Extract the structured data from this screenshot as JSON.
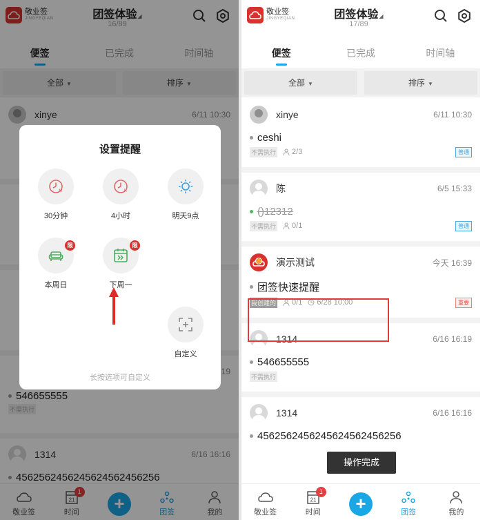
{
  "app": {
    "logo_cn": "敬业签",
    "logo_en": "JINGYEQIAN",
    "title": "团签体验",
    "title_caret": "◢"
  },
  "left": {
    "count": "16/89",
    "tabs": [
      "便签",
      "已完成",
      "时间轴"
    ],
    "filters": [
      "全部",
      "排序"
    ],
    "bg_cards": [
      {
        "name": "xinye",
        "time": "6/11 10:30"
      },
      {
        "name": "1314",
        "time": "6/16 16:16",
        "body": "4562562456245624562456256"
      }
    ],
    "bg_peek": {
      "card3_time": "6/16 16:19",
      "card3_body": "546655555",
      "card3_tag": "不需执行"
    },
    "dialog": {
      "title": "设置提醒",
      "options": [
        {
          "label": "30分钟",
          "icon": "clock-m-icon"
        },
        {
          "label": "4小时",
          "icon": "clock-h-icon"
        },
        {
          "label": "明天9点",
          "icon": "sun-icon"
        },
        {
          "label": "本周日",
          "icon": "sofa-icon",
          "badge": "限"
        },
        {
          "label": "下周一",
          "icon": "calendar-icon",
          "badge": "限"
        },
        {
          "label": "自定义",
          "icon": "custom-icon"
        }
      ],
      "hint": "长按选项可自定义"
    }
  },
  "right": {
    "count": "17/89",
    "tabs": [
      "便签",
      "已完成",
      "时间轴"
    ],
    "filters": [
      "全部",
      "排序"
    ],
    "cards": [
      {
        "name": "xinye",
        "time": "6/11 10:30",
        "body": "ceshi",
        "tag": "不需执行",
        "members": "2/3",
        "badge": "普通",
        "avatar": "photo"
      },
      {
        "name": "陈",
        "time": "6/5 15:33",
        "body": "()12312",
        "tag": "不需执行",
        "members": "0/1",
        "badge": "普通",
        "avatar": "grey",
        "done": true
      },
      {
        "name": "演示测试",
        "time": "今天 16:39",
        "body": "团签快速提醒",
        "tag": "我创建的",
        "members": "0/1",
        "remind": "6/28 10:00",
        "badge": "重要",
        "avatar": "red"
      },
      {
        "name": "1314",
        "time": "6/16 16:19",
        "body": "546655555",
        "tag": "不需执行",
        "avatar": "grey"
      },
      {
        "name": "1314",
        "time": "6/16 16:16",
        "body": "4562562456245624562456256",
        "avatar": "grey"
      }
    ],
    "toast": "操作完成"
  },
  "nav": {
    "items": [
      "敬业签",
      "时间",
      "",
      "团签",
      "我的"
    ],
    "calendar_day": "21",
    "notif_count": "1",
    "plus": "+"
  },
  "colors": {
    "accent": "#1aa7e6",
    "brand": "#d9322e",
    "highlight": "#e03a3a"
  }
}
